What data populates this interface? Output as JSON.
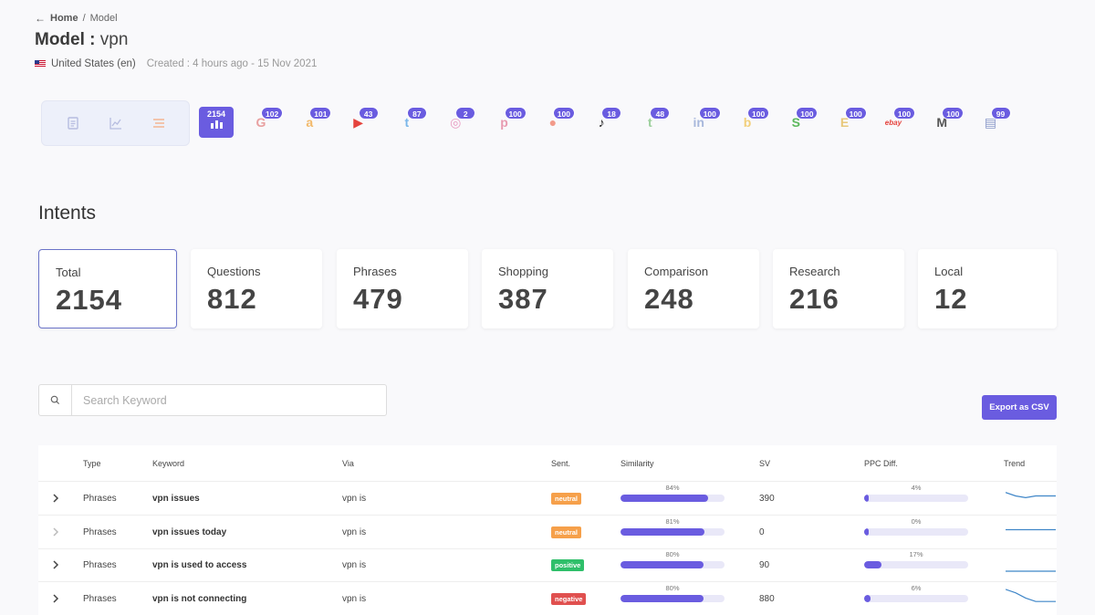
{
  "breadcrumb": {
    "home": "Home",
    "separator": "/",
    "current": "Model"
  },
  "title": {
    "prefix": "Model :",
    "name": "vpn"
  },
  "meta": {
    "country": "United States (en)",
    "created": "Created : 4 hours ago - 15 Nov 2021"
  },
  "view_modes": [
    {
      "name": "document-icon",
      "color": "#b6bce0"
    },
    {
      "name": "line-chart-icon",
      "color": "#b6bce0"
    },
    {
      "name": "list-icon",
      "color": "#f4b08a"
    }
  ],
  "sources": {
    "all": {
      "count": "2154"
    },
    "items": [
      {
        "name": "google",
        "glyph": "G",
        "count": "102",
        "color": "#e8a0a0"
      },
      {
        "name": "amazon",
        "glyph": "a",
        "count": "101",
        "color": "#f2b96a"
      },
      {
        "name": "youtube",
        "glyph": "▶",
        "count": "43",
        "color": "#e5433d"
      },
      {
        "name": "twitter",
        "glyph": "t",
        "count": "87",
        "color": "#7ab7ea"
      },
      {
        "name": "instagram",
        "glyph": "◎",
        "count": "2",
        "color": "#e89bc2"
      },
      {
        "name": "pinterest",
        "glyph": "p",
        "count": "100",
        "color": "#e89bb0"
      },
      {
        "name": "reddit",
        "glyph": "●",
        "count": "100",
        "color": "#f29a8a"
      },
      {
        "name": "tiktok",
        "glyph": "♪",
        "count": "18",
        "color": "#222222"
      },
      {
        "name": "tumblr",
        "glyph": "t",
        "count": "48",
        "color": "#9ccf9c"
      },
      {
        "name": "linkedin",
        "glyph": "in",
        "count": "100",
        "color": "#a8b8dc"
      },
      {
        "name": "bing",
        "glyph": "b",
        "count": "100",
        "color": "#f2cf7a"
      },
      {
        "name": "shopify",
        "glyph": "S",
        "count": "100",
        "color": "#5bb85b"
      },
      {
        "name": "etsy",
        "glyph": "E",
        "count": "100",
        "color": "#e8c87a"
      },
      {
        "name": "ebay",
        "glyph": "ebay",
        "count": "100",
        "color": "#e5433d"
      },
      {
        "name": "medium",
        "glyph": "M",
        "count": "100",
        "color": "#555555"
      },
      {
        "name": "news",
        "glyph": "▤",
        "count": "99",
        "color": "#8896c8"
      }
    ]
  },
  "intents": {
    "title": "Intents",
    "cards": [
      {
        "label": "Total",
        "value": "2154",
        "active": true
      },
      {
        "label": "Questions",
        "value": "812"
      },
      {
        "label": "Phrases",
        "value": "479"
      },
      {
        "label": "Shopping",
        "value": "387"
      },
      {
        "label": "Comparison",
        "value": "248"
      },
      {
        "label": "Research",
        "value": "216"
      },
      {
        "label": "Local",
        "value": "12"
      }
    ]
  },
  "search": {
    "placeholder": "Search Keyword"
  },
  "export_label": "Export as CSV",
  "table": {
    "headers": [
      "Type",
      "Keyword",
      "Via",
      "Sent.",
      "Similarity",
      "SV",
      "PPC Diff.",
      "Trend"
    ],
    "rows": [
      {
        "type": "Phrases",
        "keyword": "vpn issues",
        "via": "vpn is",
        "sentiment": "neutral",
        "similarity": 84,
        "similarity_label": "84%",
        "sv": "390",
        "ppc": 4,
        "ppc_label": "4%",
        "trend": [
          3,
          5,
          6,
          5,
          5,
          5
        ],
        "expandable": true
      },
      {
        "type": "Phrases",
        "keyword": "vpn issues today",
        "via": "vpn is",
        "sentiment": "neutral",
        "similarity": 81,
        "similarity_label": "81%",
        "sv": "0",
        "ppc": 0,
        "ppc_label": "0%",
        "trend": [
          5,
          5,
          5,
          5,
          5,
          5
        ],
        "expandable": false
      },
      {
        "type": "Phrases",
        "keyword": "vpn is used to access",
        "via": "vpn is",
        "sentiment": "positive",
        "similarity": 80,
        "similarity_label": "80%",
        "sv": "90",
        "ppc": 17,
        "ppc_label": "17%",
        "trend": [
          10,
          10,
          10,
          10,
          10,
          10
        ],
        "expandable": true
      },
      {
        "type": "Phrases",
        "keyword": "vpn is not connecting",
        "via": "vpn is",
        "sentiment": "negative",
        "similarity": 80,
        "similarity_label": "80%",
        "sv": "880",
        "ppc": 6,
        "ppc_label": "6%",
        "trend": [
          1,
          3,
          6,
          8,
          8,
          8
        ],
        "expandable": true
      }
    ]
  }
}
